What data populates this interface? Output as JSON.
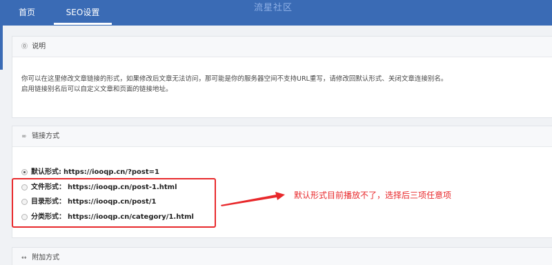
{
  "header": {
    "tabs": [
      {
        "label": "首页"
      },
      {
        "label": "SEO设置"
      }
    ],
    "watermark": "流星社区"
  },
  "panels": {
    "info": {
      "icon": "question-icon",
      "title": "说明",
      "lines": [
        "你可以在这里修改文章链接的形式，如果修改后文章无法访问，那可能是你的服务器空间不支持URL重写，请修改回默认形式、关闭文章连接别名。",
        "启用链接别名后可以自定义文章和页面的链接地址。"
      ]
    },
    "link_mode": {
      "icon": "link-icon",
      "title": "链接方式",
      "options": [
        {
          "label": "默认形式:",
          "url": "https://iooqp.cn/?post=1",
          "checked": true
        },
        {
          "label": "文件形式：",
          "url": "https://iooqp.cn/post-1.html",
          "checked": false
        },
        {
          "label": "目录形式：",
          "url": "https://iooqp.cn/post/1",
          "checked": false
        },
        {
          "label": "分类形式：",
          "url": "https://iooqp.cn/category/1.html",
          "checked": false
        }
      ]
    },
    "extra": {
      "icon": "code-icon",
      "title": "附加方式"
    }
  },
  "annotation": {
    "note": "默认形式目前播放不了，选择后三项任意项",
    "color": "#e8282b"
  },
  "colors": {
    "topbar": "#3a6bb5",
    "background": "#f0f2f5"
  }
}
